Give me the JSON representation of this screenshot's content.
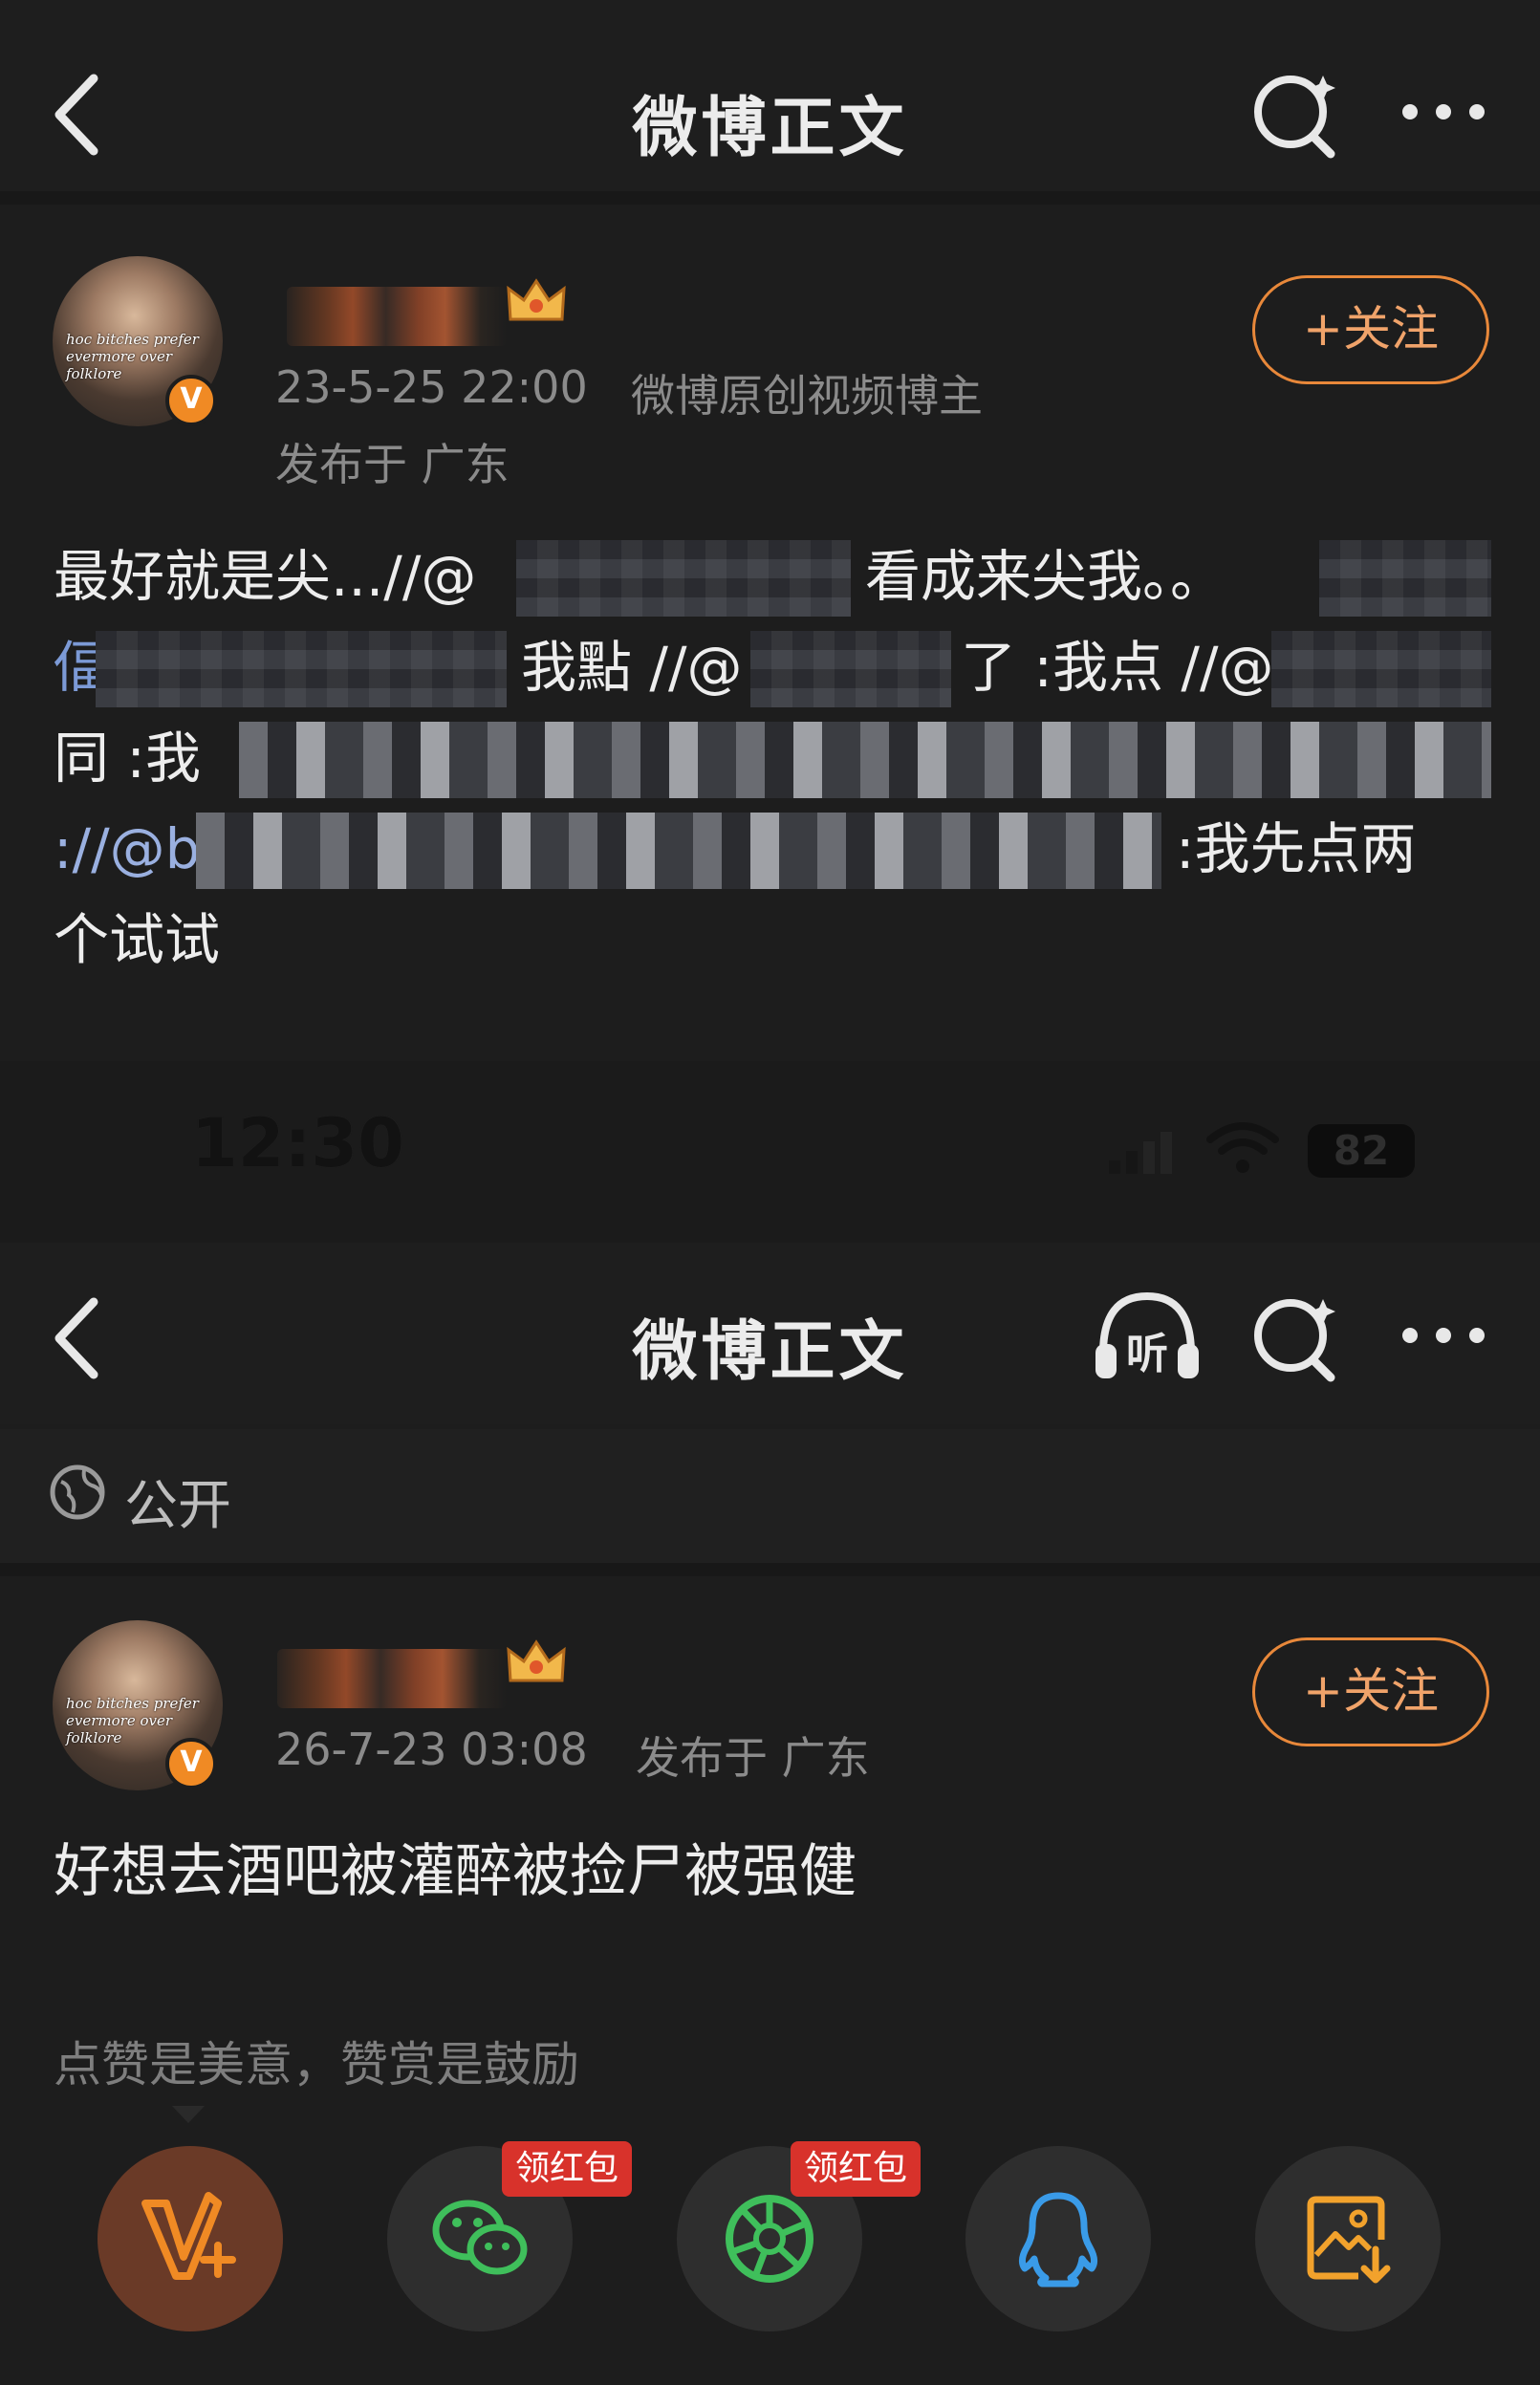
{
  "top_screen": {
    "nav": {
      "title": "微博正文"
    },
    "post": {
      "timestamp": "23-5-25 22:00",
      "author_tag": "微博原创视频博主",
      "location": "发布于 广东",
      "follow_label": "+关注",
      "avatar_caption": "hoc bitches prefer evermore over folklore",
      "badge": "V",
      "lines": {
        "l1a": "最好就是尖...//@",
        "l1b": "看成来尖我。。",
        "l2a": "偪",
        "l2b": "我點 //@",
        "l2c": "了 :我点 //@",
        "l3a": "同 :我",
        "l4a": "://@b",
        "l4b": ":我先点两",
        "l5": "个试试"
      }
    }
  },
  "status_bar": {
    "time": "12:30",
    "battery": "82"
  },
  "bottom_screen": {
    "nav": {
      "title": "微博正文",
      "listen_label": "听"
    },
    "visibility": "公开",
    "post": {
      "timestamp": "26-7-23 03:08",
      "location": "发布于 广东",
      "follow_label": "+关注",
      "avatar_caption": "hoc bitches prefer evermore over folklore",
      "badge": "V",
      "text": "好想去酒吧被灌醉被捡尸被强健"
    },
    "like_hint": "点赞是美意，赞赏是鼓励",
    "share": {
      "red_packet_label_1": "领红包",
      "red_packet_label_2": "领红包",
      "buttons": [
        "v-plus-icon",
        "wechat-icon",
        "moments-icon",
        "qq-icon",
        "save-image-icon"
      ]
    }
  },
  "colors": {
    "background": "#1d1d1d",
    "accent_orange": "#f08a24",
    "wechat_green": "#3fbf5b",
    "qq_blue": "#3a9be8",
    "red_packet": "#d8322b"
  }
}
